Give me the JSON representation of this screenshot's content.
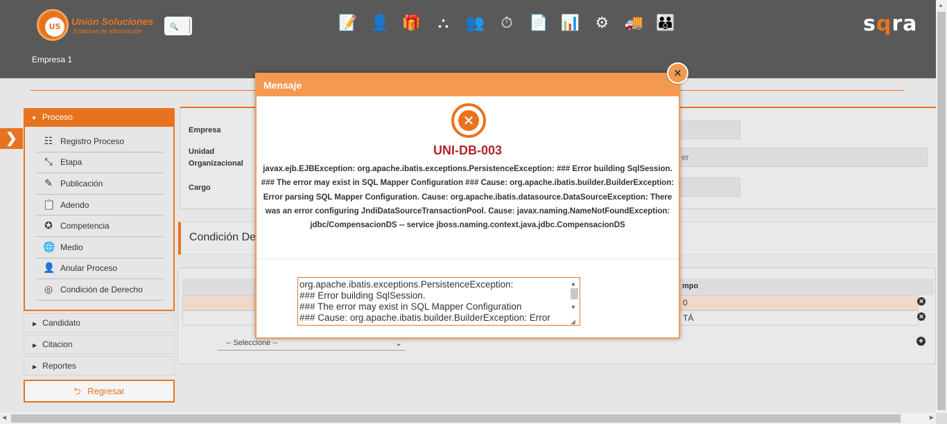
{
  "header": {
    "logo_badge": "US",
    "logo_name": "Unión Soluciones",
    "logo_tagline": "Sistemas de Información",
    "brand_prefix": "s",
    "brand_accent": "q",
    "brand_suffix": "ra",
    "company": "Empresa 1",
    "search_icon": "🔍",
    "toolbar_icons": [
      {
        "name": "document-edit-icon",
        "glyph": "📝"
      },
      {
        "name": "user-money-icon",
        "glyph": "👤"
      },
      {
        "name": "gift-icon",
        "glyph": "🎁"
      },
      {
        "name": "org-chart-icon",
        "glyph": "⛬"
      },
      {
        "name": "user-chart-icon",
        "glyph": "👥"
      },
      {
        "name": "timer-icon",
        "glyph": "⏱"
      },
      {
        "name": "report-icon",
        "glyph": "📄"
      },
      {
        "name": "presentation-icon",
        "glyph": "📊"
      },
      {
        "name": "settings-icon",
        "glyph": "⚙"
      },
      {
        "name": "truck-settings-icon",
        "glyph": "🚚"
      },
      {
        "name": "users-group-icon",
        "glyph": "👪"
      }
    ]
  },
  "menu": {
    "section_label": "Proceso",
    "items": [
      {
        "label": "Registro Proceso",
        "icon": "☷"
      },
      {
        "label": "Etapa",
        "icon": "⤡"
      },
      {
        "label": "Publicación",
        "icon": "✎"
      },
      {
        "label": "Adendo",
        "icon": "📋"
      },
      {
        "label": "Competencia",
        "icon": "✪"
      },
      {
        "label": "Medio",
        "icon": "🌐"
      },
      {
        "label": "Anular Proceso",
        "icon": "👤"
      },
      {
        "label": "Condición de Derecho",
        "icon": "◎"
      }
    ],
    "collapsed": [
      "Candidato",
      "Citacion",
      "Reportes"
    ],
    "back_label": "Regresar",
    "back_icon": "⮌"
  },
  "form": {
    "empresa_label": "Empresa",
    "unidad_label_1": "Unidad",
    "unidad_label_2": "Organizacional",
    "cargo_label": "Cargo",
    "unidad_value_tail": "er"
  },
  "section": {
    "title_visible": "Condición De"
  },
  "grid": {
    "header_tail": "mpo",
    "row1_tail": "0",
    "row2_tail": "TÁ",
    "select_value": "-- Seleccione --"
  },
  "dialog": {
    "title": "Mensaje",
    "close_glyph": "×",
    "error_code": "UNI-DB-003",
    "error_message": "javax.ejb.EJBException: org.apache.ibatis.exceptions.PersistenceException: ### Error building SqlSession. ### The error may exist in SQL Mapper Configuration ### Cause: org.apache.ibatis.builder.BuilderException: Error parsing SQL Mapper Configuration. Cause: org.apache.ibatis.datasource.DataSourceException: There was an error configuring JndiDataSourceTransactionPool. Cause: javax.naming.NameNotFoundException: jdbc/CompensacionDS -- service jboss.naming.context.java.jdbc.CompensacionDS",
    "detail_lines": [
      "org.apache.ibatis.exceptions.PersistenceException:",
      "### Error building SqlSession.",
      "### The error may exist in SQL Mapper Configuration",
      "### Cause: org.apache.ibatis.builder.BuilderException: Error"
    ]
  },
  "colors": {
    "accent": "#e8731f",
    "dialog_header": "#f49a50",
    "error_red": "#b0272b",
    "topbar": "#595959"
  }
}
